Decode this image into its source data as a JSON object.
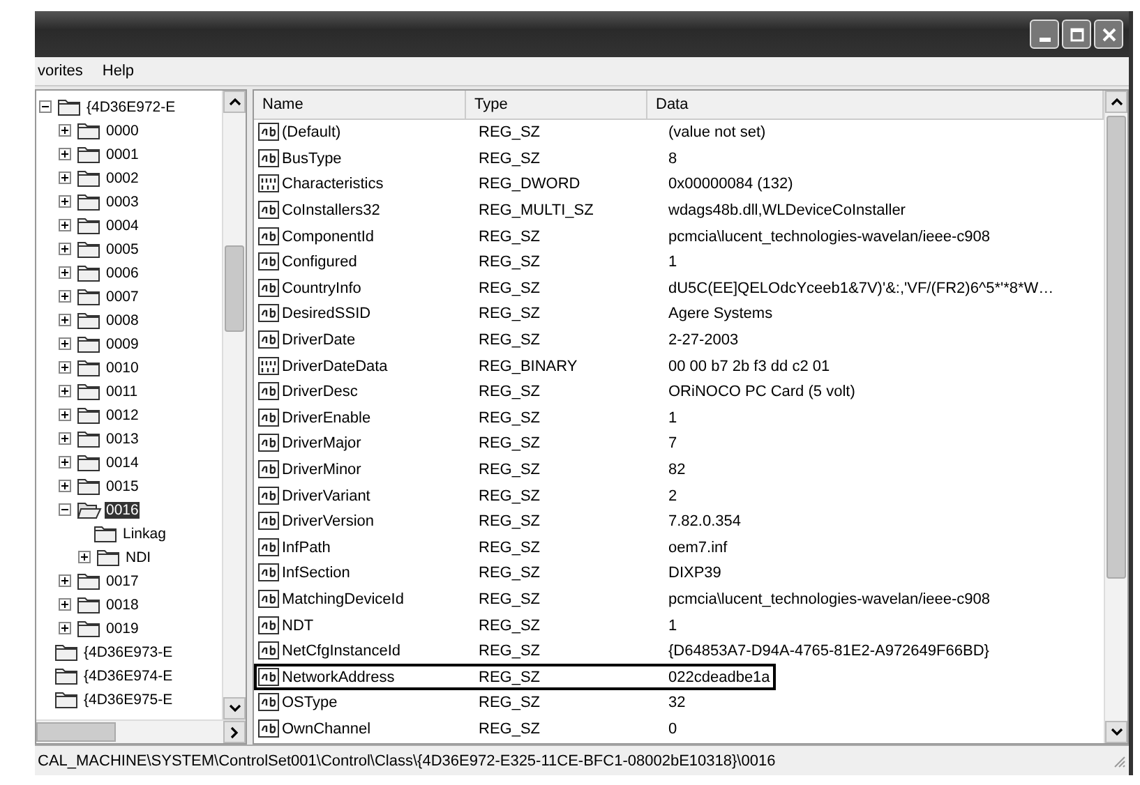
{
  "menu": [
    {
      "label": "vorites"
    },
    {
      "label": "Help"
    }
  ],
  "tree": [
    {
      "label": "{4D36E972-E",
      "expanded": true,
      "selected": false,
      "children": [
        {
          "label": "0000",
          "expanded": false,
          "selected": false
        },
        {
          "label": "0001",
          "expanded": false,
          "selected": false
        },
        {
          "label": "0002",
          "expanded": false,
          "selected": false
        },
        {
          "label": "0003",
          "expanded": false,
          "selected": false
        },
        {
          "label": "0004",
          "expanded": false,
          "selected": false
        },
        {
          "label": "0005",
          "expanded": false,
          "selected": false
        },
        {
          "label": "0006",
          "expanded": false,
          "selected": false
        },
        {
          "label": "0007",
          "expanded": false,
          "selected": false
        },
        {
          "label": "0008",
          "expanded": false,
          "selected": false
        },
        {
          "label": "0009",
          "expanded": false,
          "selected": false
        },
        {
          "label": "0010",
          "expanded": false,
          "selected": false
        },
        {
          "label": "0011",
          "expanded": false,
          "selected": false
        },
        {
          "label": "0012",
          "expanded": false,
          "selected": false
        },
        {
          "label": "0013",
          "expanded": false,
          "selected": false
        },
        {
          "label": "0014",
          "expanded": false,
          "selected": false
        },
        {
          "label": "0015",
          "expanded": false,
          "selected": false
        },
        {
          "label": "0016",
          "expanded": true,
          "selected": true,
          "children": [
            {
              "label": "Linkag",
              "selected": false
            },
            {
              "label": "NDI",
              "expanded": false,
              "selected": false
            }
          ]
        },
        {
          "label": "0017",
          "expanded": false,
          "selected": false
        },
        {
          "label": "0018",
          "expanded": false,
          "selected": false
        },
        {
          "label": "0019",
          "expanded": false,
          "selected": false
        }
      ]
    },
    {
      "label": "{4D36E973-E",
      "selected": false
    },
    {
      "label": "{4D36E974-E",
      "selected": false
    },
    {
      "label": "{4D36E975-E",
      "selected": false
    }
  ],
  "table": {
    "columns": [
      "Name",
      "Type",
      "Data"
    ],
    "rows": [
      {
        "kind": "string",
        "name": "(Default)",
        "type": "REG_SZ",
        "data": "(value not set)",
        "highlighted": false
      },
      {
        "kind": "string",
        "name": "BusType",
        "type": "REG_SZ",
        "data": "8",
        "highlighted": false
      },
      {
        "kind": "binary",
        "name": "Characteristics",
        "type": "REG_DWORD",
        "data": "0x00000084 (132)",
        "highlighted": false
      },
      {
        "kind": "string",
        "name": "CoInstallers32",
        "type": "REG_MULTI_SZ",
        "data": "wdags48b.dll,WLDeviceCoInstaller",
        "highlighted": false
      },
      {
        "kind": "string",
        "name": "ComponentId",
        "type": "REG_SZ",
        "data": "pcmcia\\lucent_technologies-wavelan/ieee-c908",
        "highlighted": false
      },
      {
        "kind": "string",
        "name": "Configured",
        "type": "REG_SZ",
        "data": "1",
        "highlighted": false
      },
      {
        "kind": "string",
        "name": "CountryInfo",
        "type": "REG_SZ",
        "data": "dU5C(EE]QELOdcYceeb1&7V)'&:,'VF/(FR2)6^5*'*8*W…",
        "highlighted": false
      },
      {
        "kind": "string",
        "name": "DesiredSSID",
        "type": "REG_SZ",
        "data": "Agere Systems",
        "highlighted": false
      },
      {
        "kind": "string",
        "name": "DriverDate",
        "type": "REG_SZ",
        "data": "2-27-2003",
        "highlighted": false
      },
      {
        "kind": "binary",
        "name": "DriverDateData",
        "type": "REG_BINARY",
        "data": "00 00 b7 2b f3 dd c2 01",
        "highlighted": false
      },
      {
        "kind": "string",
        "name": "DriverDesc",
        "type": "REG_SZ",
        "data": "ORiNOCO PC Card (5 volt)",
        "highlighted": false
      },
      {
        "kind": "string",
        "name": "DriverEnable",
        "type": "REG_SZ",
        "data": "1",
        "highlighted": false
      },
      {
        "kind": "string",
        "name": "DriverMajor",
        "type": "REG_SZ",
        "data": "7",
        "highlighted": false
      },
      {
        "kind": "string",
        "name": "DriverMinor",
        "type": "REG_SZ",
        "data": "82",
        "highlighted": false
      },
      {
        "kind": "string",
        "name": "DriverVariant",
        "type": "REG_SZ",
        "data": "2",
        "highlighted": false
      },
      {
        "kind": "string",
        "name": "DriverVersion",
        "type": "REG_SZ",
        "data": "7.82.0.354",
        "highlighted": false
      },
      {
        "kind": "string",
        "name": "InfPath",
        "type": "REG_SZ",
        "data": "oem7.inf",
        "highlighted": false
      },
      {
        "kind": "string",
        "name": "InfSection",
        "type": "REG_SZ",
        "data": "DIXP39",
        "highlighted": false
      },
      {
        "kind": "string",
        "name": "MatchingDeviceId",
        "type": "REG_SZ",
        "data": "pcmcia\\lucent_technologies-wavelan/ieee-c908",
        "highlighted": false
      },
      {
        "kind": "string",
        "name": "NDT",
        "type": "REG_SZ",
        "data": "1",
        "highlighted": false
      },
      {
        "kind": "string",
        "name": "NetCfgInstanceId",
        "type": "REG_SZ",
        "data": "{D64853A7-D94A-4765-81E2-A972649F66BD}",
        "highlighted": false
      },
      {
        "kind": "string",
        "name": "NetworkAddress",
        "type": "REG_SZ",
        "data": "022cdeadbe1a",
        "highlighted": true
      },
      {
        "kind": "string",
        "name": "OSType",
        "type": "REG_SZ",
        "data": "32",
        "highlighted": false
      },
      {
        "kind": "string",
        "name": "OwnChannel",
        "type": "REG_SZ",
        "data": "0",
        "highlighted": false
      }
    ]
  },
  "status_bar": "CAL_MACHINE\\SYSTEM\\ControlSet001\\Control\\Class\\{4D36E972-E325-11CE-BFC1-08002bE10318}\\0016"
}
